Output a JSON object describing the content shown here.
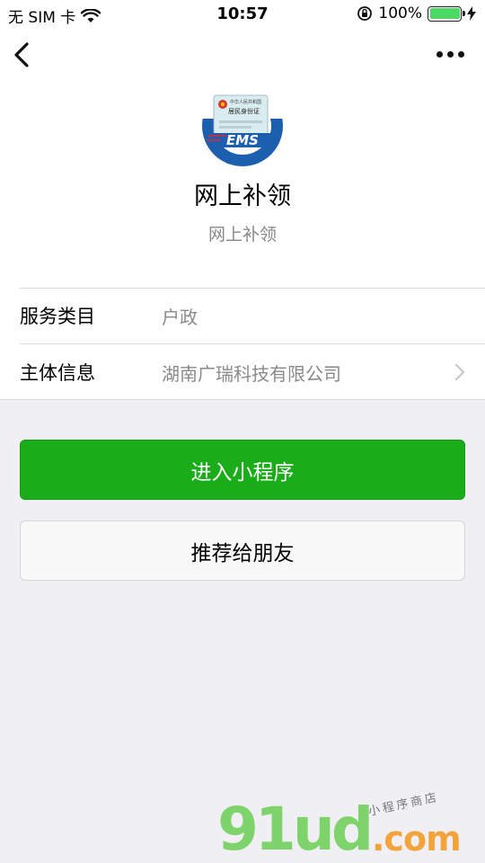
{
  "status_bar": {
    "carrier": "无 SIM 卡",
    "time": "10:57",
    "battery_percent": "100%",
    "battery_level": 1.0
  },
  "header": {
    "title": "网上补领",
    "subtitle": "网上补领"
  },
  "logo": {
    "card_text_top": "中华人民共和国",
    "card_text_mid": "居民身份证",
    "brand": "EMS"
  },
  "info": {
    "rows": [
      {
        "label": "服务类目",
        "value": "户政"
      },
      {
        "label": "主体信息",
        "value": "湖南广瑞科技有限公司"
      }
    ]
  },
  "actions": {
    "primary_label": "进入小程序",
    "secondary_label": "推荐给朋友"
  },
  "watermark": {
    "logo": "91ud",
    "domain": ".com",
    "tagline": "小程序商店"
  },
  "colors": {
    "primary_green": "#1aad19",
    "background": "#efeff4",
    "battery_green": "#4cd964"
  }
}
